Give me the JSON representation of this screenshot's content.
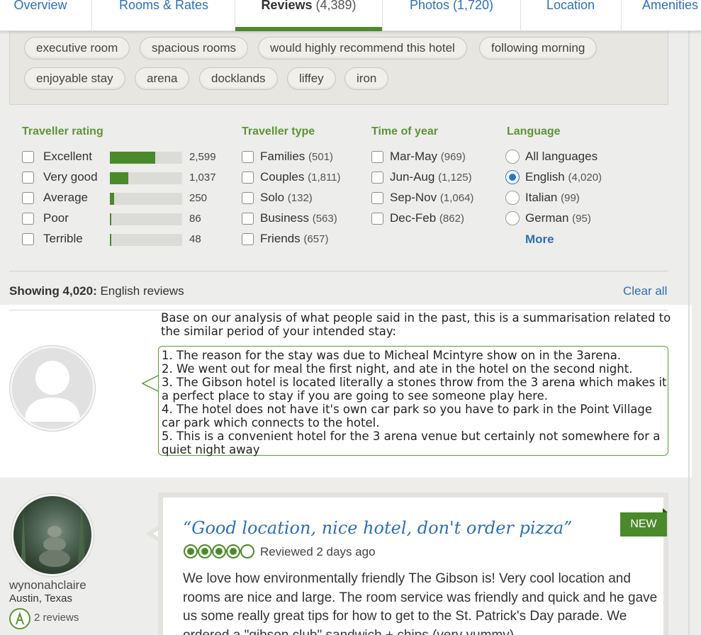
{
  "tabs": [
    {
      "label": "Overview",
      "count": ""
    },
    {
      "label": "Rooms & Rates",
      "count": ""
    },
    {
      "label": "Reviews",
      "count": "(4,389)"
    },
    {
      "label": "Photos",
      "count": "(1,720)"
    },
    {
      "label": "Location",
      "count": ""
    },
    {
      "label": "Amenities",
      "count": ""
    }
  ],
  "keywords": [
    "executive room",
    "spacious rooms",
    "would highly recommend this hotel",
    "following morning",
    "enjoyable stay",
    "arena",
    "docklands",
    "liffey",
    "iron"
  ],
  "filters": {
    "traveller_rating": {
      "title": "Traveller rating",
      "items": [
        {
          "label": "Excellent",
          "count": "2,599",
          "fraction": 0.63
        },
        {
          "label": "Very good",
          "count": "1,037",
          "fraction": 0.25
        },
        {
          "label": "Average",
          "count": "250",
          "fraction": 0.06
        },
        {
          "label": "Poor",
          "count": "86",
          "fraction": 0.02
        },
        {
          "label": "Terrible",
          "count": "48",
          "fraction": 0.0
        }
      ]
    },
    "traveller_type": {
      "title": "Traveller type",
      "items": [
        {
          "label": "Families",
          "count": "(501)"
        },
        {
          "label": "Couples",
          "count": "(1,811)"
        },
        {
          "label": "Solo",
          "count": "(132)"
        },
        {
          "label": "Business",
          "count": "(563)"
        },
        {
          "label": "Friends",
          "count": "(657)"
        }
      ]
    },
    "time_of_year": {
      "title": "Time of year",
      "items": [
        {
          "label": "Mar-May",
          "count": "(969)"
        },
        {
          "label": "Jun-Aug",
          "count": "(1,125)"
        },
        {
          "label": "Sep-Nov",
          "count": "(1,064)"
        },
        {
          "label": "Dec-Feb",
          "count": "(862)"
        }
      ]
    },
    "language": {
      "title": "Language",
      "items": [
        {
          "label": "All languages",
          "count": "",
          "selected": false
        },
        {
          "label": "English",
          "count": "(4,020)",
          "selected": true
        },
        {
          "label": "Italian",
          "count": "(99)",
          "selected": false
        },
        {
          "label": "German",
          "count": "(95)",
          "selected": false
        }
      ],
      "more_label": "More"
    }
  },
  "showing": {
    "bold": "Showing 4,020:",
    "rest": " English reviews",
    "clear_all": "Clear all"
  },
  "summary": {
    "intro": "Base on our analysis of what people said in the past, this is a summarisation related to the similar period of your intended stay:",
    "points": [
      "1. The reason for the stay was due to Micheal Mcintyre show on in the 3arena.",
      "2. We went out for meal the first night, and ate in the hotel on the second night.",
      "3. The Gibson hotel is located literally a stones throw from the 3 arena which makes it a perfect place to stay if you are going to see someone play here.",
      "4. The hotel does not have it's own car park so you have to park in the Point Village car park which connects to the hotel.",
      "5. This is a convenient hotel for the 3 arena venue but certainly not somewhere for a quiet night away"
    ]
  },
  "review": {
    "username": "wynonahclaire",
    "location": "Austin, Texas",
    "reviews_count": "2 reviews",
    "title": "“Good location, nice hotel, don't order pizza”",
    "rating": 4,
    "reviewed": "Reviewed 2 days ago",
    "badge": "NEW",
    "body": "We love how environmentally friendly The Gibson is! Very cool location and rooms are nice and large. The room service was friendly and quick and he gave us some really great tips for how to get to the St. Patrick's Day parade. We ordered a \"gibson club\" sandwich + chips (very yummy)"
  },
  "colors": {
    "accent_green": "#4b8a2b",
    "link_blue": "#2f6fb3",
    "radio_blue": "#2b74c6"
  }
}
